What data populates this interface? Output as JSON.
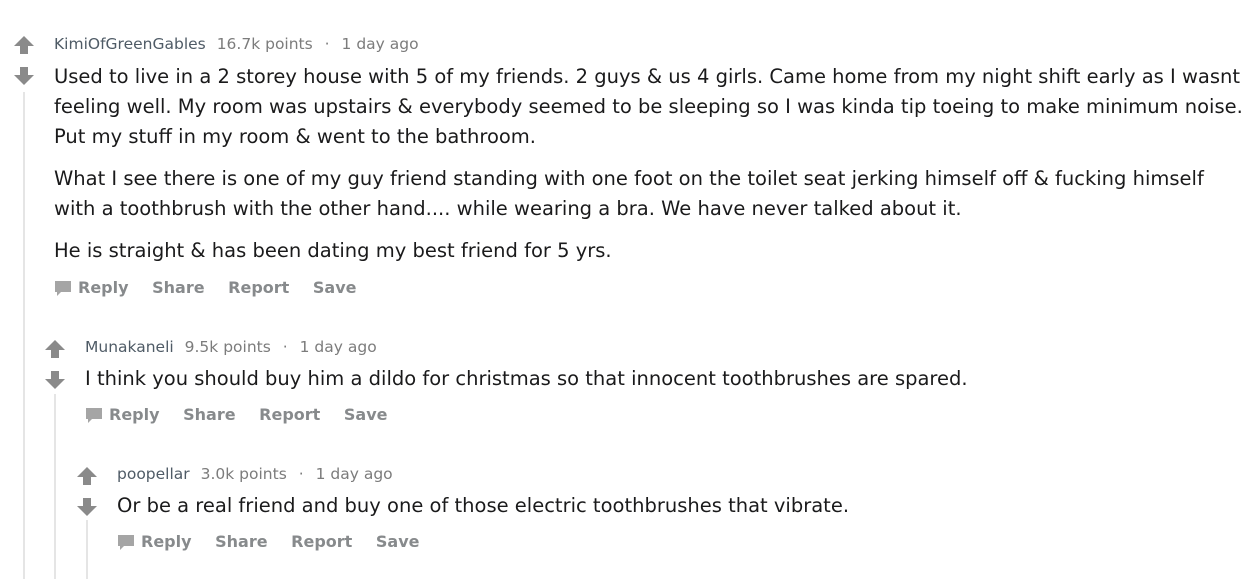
{
  "comments": [
    {
      "author": "KimiOfGreenGables",
      "points": "16.7k points",
      "separator": "·",
      "time": "1 day ago",
      "paragraphs": [
        "Used to live in a 2 storey house with 5 of my friends. 2 guys & us 4 girls. Came home from my night shift early as I wasnt feeling well. My room was upstairs & everybody seemed to be sleeping so I was kinda tip toeing to make minimum noise. Put my stuff in my room & went to the bathroom.",
        "What I see there is one of my guy friend standing with one foot on the toilet seat jerking himself off & fucking himself with a toothbrush with the other hand.... while wearing a bra. We have never talked about it.",
        "He is straight & has been dating my best friend for 5 yrs."
      ],
      "actions": {
        "reply": "Reply",
        "share": "Share",
        "report": "Report",
        "save": "Save"
      }
    },
    {
      "author": "Munakaneli",
      "points": "9.5k points",
      "separator": "·",
      "time": "1 day ago",
      "paragraphs": [
        "I think you should buy him a dildo for christmas so that innocent toothbrushes are spared."
      ],
      "actions": {
        "reply": "Reply",
        "share": "Share",
        "report": "Report",
        "save": "Save"
      }
    },
    {
      "author": "poopellar",
      "points": "3.0k points",
      "separator": "·",
      "time": "1 day ago",
      "paragraphs": [
        "Or be a real friend and buy one of those electric toothbrushes that vibrate."
      ],
      "actions": {
        "reply": "Reply",
        "share": "Share",
        "report": "Report",
        "save": "Save"
      }
    }
  ],
  "colors": {
    "arrow": "#8a8a8a",
    "meta": "#7c7c7c",
    "author": "#4f5b66",
    "actions": "#878a8c",
    "thread_line": "#e5e5e5"
  }
}
